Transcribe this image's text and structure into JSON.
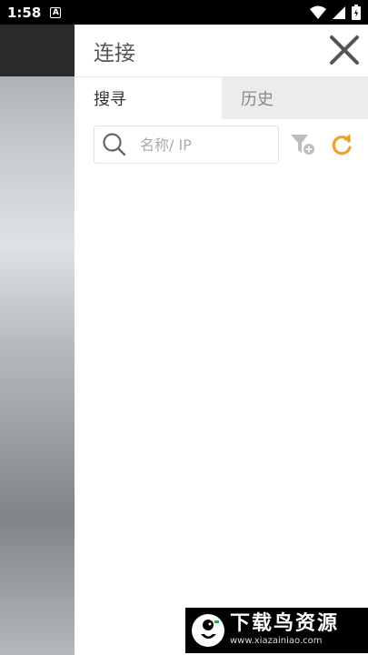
{
  "status_bar": {
    "time": "1:58",
    "notification_icon": "A"
  },
  "drawer": {
    "title": "连接",
    "tabs": [
      {
        "label": "搜寻",
        "active": true
      },
      {
        "label": "历史",
        "active": false
      }
    ],
    "search": {
      "placeholder": "名称/ IP",
      "value": ""
    }
  },
  "watermark": {
    "title": "下载鸟资源",
    "url": "www.xiazainiao.com"
  },
  "colors": {
    "accent": "#f0a030",
    "tab_inactive_bg": "#ececec",
    "title_text": "#555555"
  }
}
